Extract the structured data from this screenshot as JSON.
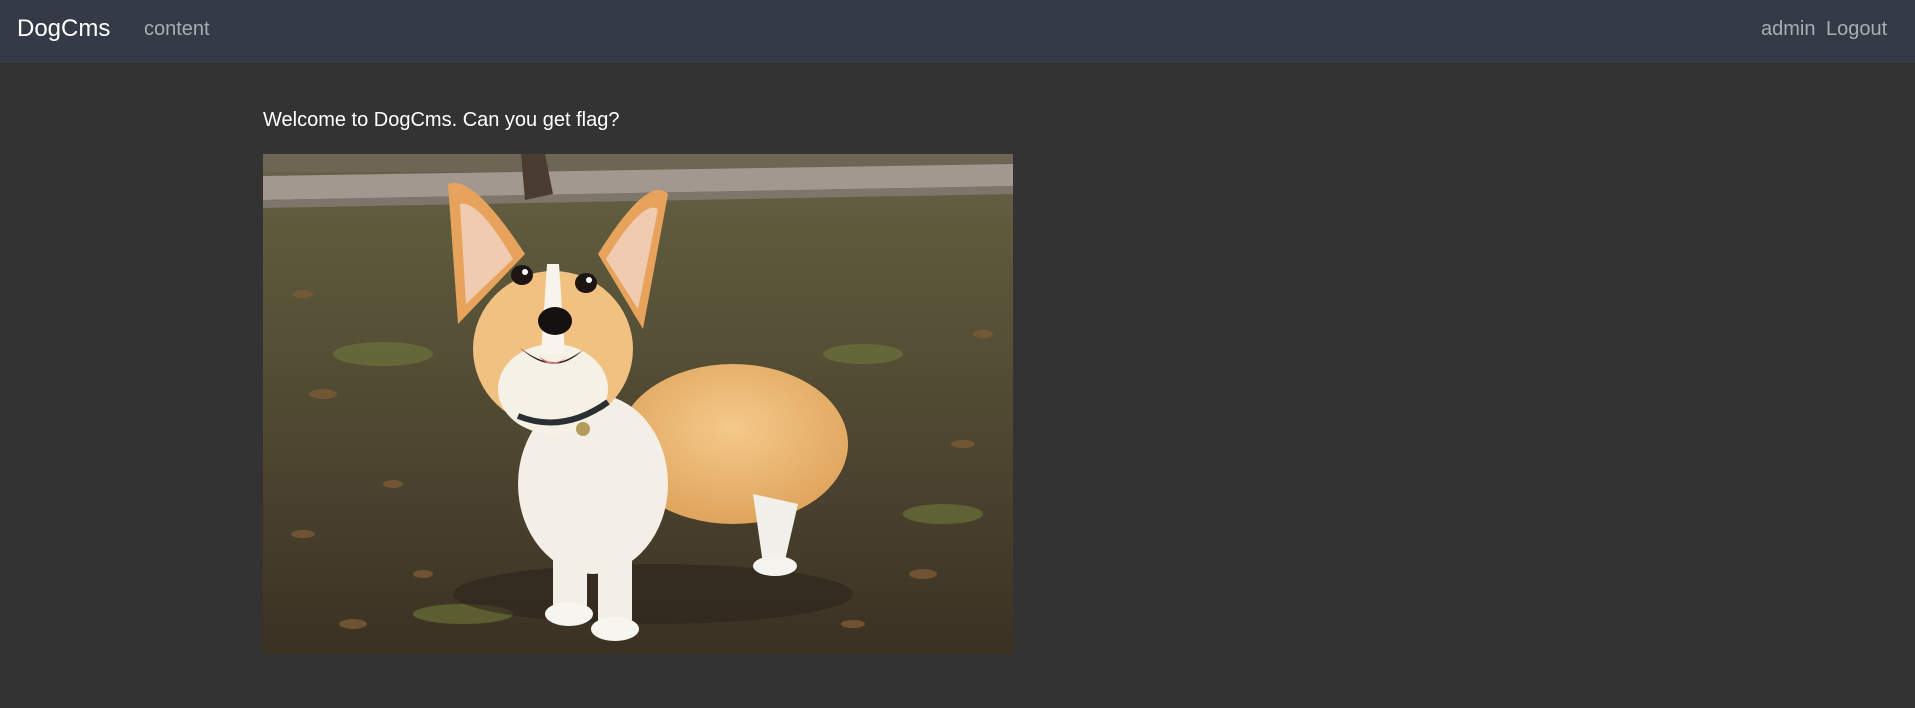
{
  "navbar": {
    "brand": "DogCms",
    "links": {
      "content": "content",
      "admin": "admin",
      "logout": "Logout"
    },
    "background": "#343a46"
  },
  "main": {
    "welcome_text": "Welcome to DogCms. Can you get flag?",
    "image": {
      "subject": "corgi-photo"
    },
    "background": "#333333"
  }
}
